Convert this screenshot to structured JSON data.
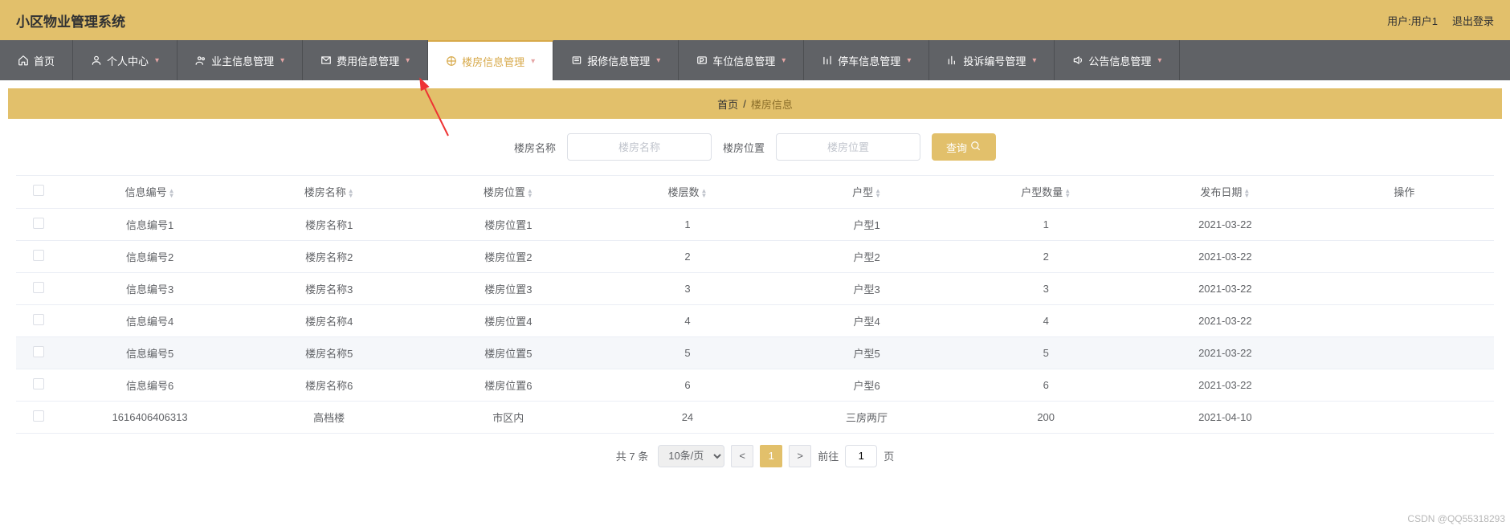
{
  "header": {
    "title": "小区物业管理系统",
    "user_label": "用户:用户1",
    "logout": "退出登录"
  },
  "nav": [
    {
      "label": "首页",
      "icon": "home",
      "caret": false
    },
    {
      "label": "个人中心",
      "icon": "user",
      "caret": true
    },
    {
      "label": "业主信息管理",
      "icon": "owner",
      "caret": true
    },
    {
      "label": "费用信息管理",
      "icon": "fee",
      "caret": true
    },
    {
      "label": "楼房信息管理",
      "icon": "building",
      "caret": true,
      "active": true
    },
    {
      "label": "报修信息管理",
      "icon": "repair",
      "caret": true
    },
    {
      "label": "车位信息管理",
      "icon": "parklot",
      "caret": true
    },
    {
      "label": "停车信息管理",
      "icon": "parking",
      "caret": true
    },
    {
      "label": "投诉编号管理",
      "icon": "complaint",
      "caret": true
    },
    {
      "label": "公告信息管理",
      "icon": "notice",
      "caret": true
    }
  ],
  "breadcrumb": {
    "home": "首页",
    "current": "楼房信息"
  },
  "search": {
    "name_label": "楼房名称",
    "name_placeholder": "楼房名称",
    "pos_label": "楼房位置",
    "pos_placeholder": "楼房位置",
    "btn": "查询"
  },
  "table": {
    "columns": [
      "信息编号",
      "楼房名称",
      "楼房位置",
      "楼层数",
      "户型",
      "户型数量",
      "发布日期",
      "操作"
    ],
    "rows": [
      {
        "id": "信息编号1",
        "name": "楼房名称1",
        "pos": "楼房位置1",
        "floors": "1",
        "type": "户型1",
        "count": "1",
        "date": "2021-03-22"
      },
      {
        "id": "信息编号2",
        "name": "楼房名称2",
        "pos": "楼房位置2",
        "floors": "2",
        "type": "户型2",
        "count": "2",
        "date": "2021-03-22"
      },
      {
        "id": "信息编号3",
        "name": "楼房名称3",
        "pos": "楼房位置3",
        "floors": "3",
        "type": "户型3",
        "count": "3",
        "date": "2021-03-22"
      },
      {
        "id": "信息编号4",
        "name": "楼房名称4",
        "pos": "楼房位置4",
        "floors": "4",
        "type": "户型4",
        "count": "4",
        "date": "2021-03-22"
      },
      {
        "id": "信息编号5",
        "name": "楼房名称5",
        "pos": "楼房位置5",
        "floors": "5",
        "type": "户型5",
        "count": "5",
        "date": "2021-03-22",
        "hover": true
      },
      {
        "id": "信息编号6",
        "name": "楼房名称6",
        "pos": "楼房位置6",
        "floors": "6",
        "type": "户型6",
        "count": "6",
        "date": "2021-03-22"
      },
      {
        "id": "1616406406313",
        "name": "高档楼",
        "pos": "市区内",
        "floors": "24",
        "type": "三房两厅",
        "count": "200",
        "date": "2021-04-10"
      }
    ]
  },
  "pager": {
    "total_label": "共 7 条",
    "page_size_label": "10条/页",
    "current_page": "1",
    "jump_label_prefix": "前往",
    "jump_label_suffix": "页",
    "jump_value": "1"
  },
  "watermark": "CSDN @QQ55318293"
}
